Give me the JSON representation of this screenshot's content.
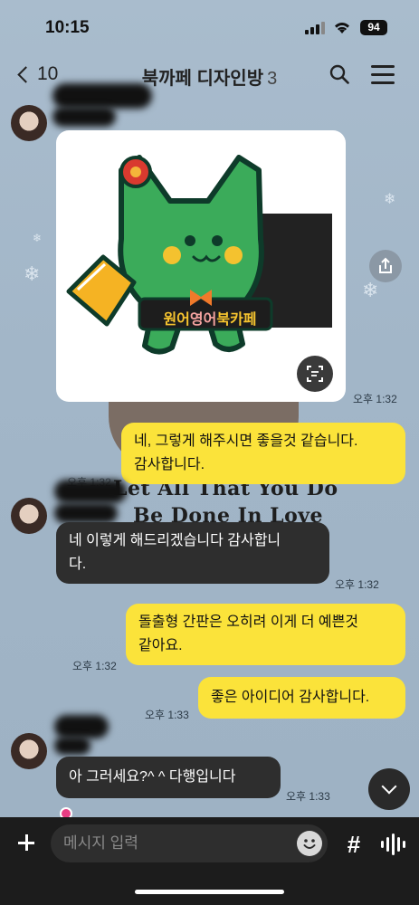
{
  "status_bar": {
    "time": "10:15",
    "battery": "94"
  },
  "header": {
    "back_count": "10",
    "title": "북까페 디자인방",
    "member_count": "3"
  },
  "image_card": {
    "sign_text_1": "원어",
    "sign_text_2": "영어",
    "sign_text_3": "북카페"
  },
  "background_quote": {
    "line1": "Let All That You Do",
    "line2": "Be Done In Love"
  },
  "messages": [
    {
      "side": "them",
      "type": "image",
      "time": "오후 1:32"
    },
    {
      "side": "me",
      "text_line1": "네, 그렇게 해주시면 좋을것 같습니다.",
      "text_line2": "감사합니다.",
      "time": "오후 1:32"
    },
    {
      "side": "them",
      "text_line1": "네 이렇게 해드리겠습니다 감사합니",
      "text_line2": "다.",
      "time": "오후 1:32"
    },
    {
      "side": "me",
      "text_line1": "돌출형 간판은 오히려 이게 더 예쁜것",
      "text_line2": "같아요.",
      "time": "오후 1:32"
    },
    {
      "side": "me",
      "text": "좋은 아이디어 감사합니다.",
      "time": "오후 1:33"
    },
    {
      "side": "them",
      "text": "아 그러세요?^ ^ 다행입니다",
      "time": "오후 1:33"
    }
  ],
  "input": {
    "placeholder": "메시지 입력",
    "hash": "#"
  },
  "icons": [
    "back-chevron-icon",
    "search-icon",
    "menu-icon",
    "share-icon",
    "scan-icon",
    "chevron-down-icon",
    "plus-icon",
    "emoji-icon",
    "hashtag-icon",
    "voice-icon"
  ],
  "colors": {
    "my_bubble": "#fbe33a",
    "their_bubble": "#2e2e2e",
    "background": "#a2b6c8",
    "input_bar": "#1c1c1c"
  }
}
